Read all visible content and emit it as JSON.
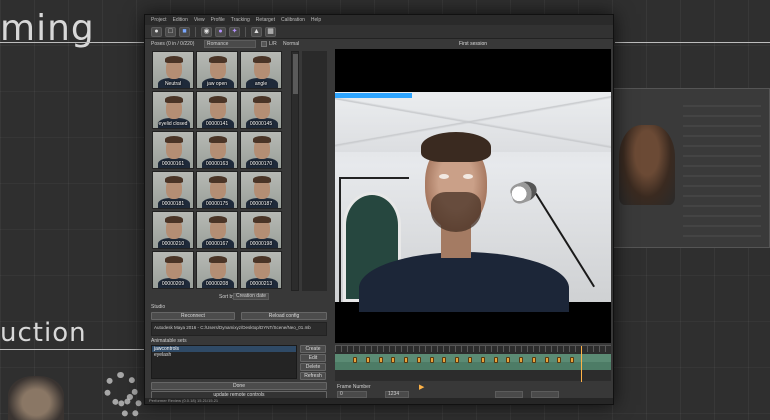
{
  "background": {
    "top_word": "ming",
    "bottom_word": "uction"
  },
  "app": {
    "menu": [
      "Project",
      "Edition",
      "View",
      "Profile",
      "Tracking",
      "Retarget",
      "Calibration",
      "Help"
    ],
    "toolbar_icons": [
      "profile-icon",
      "open-icon",
      "save-icon",
      "camera-icon",
      "record-icon",
      "pose-icon",
      "shape-icon",
      "window-icon"
    ],
    "left": {
      "header_title": "Poses (0 in / 0/220)",
      "view_select": "Romance",
      "lr_label": "L/R",
      "normal_label": "Normal",
      "thumbnails": [
        "Neutral",
        "jaw open",
        "angle",
        "eyelid closed",
        "00000141",
        "00000145",
        "00000161",
        "00000163",
        "00000170",
        "00000181",
        "00000175",
        "00000187",
        "00000210",
        "00000167",
        "00000198",
        "00000209",
        "00000208",
        "00000213"
      ],
      "sort_label": "Sort by",
      "sort_value": "Creation date",
      "studio_label": "Studio",
      "reconnect_button": "Reconnect",
      "config_button": "Reload config",
      "path_text": "Autodesk Maya 2016 - C:/Users/Dynamixyz/Desktop/DYNT/Scene/Neo_01.mb",
      "anim_label": "Animatable sets",
      "anim_items": [
        {
          "label": "jawcontrols",
          "selected": true
        },
        {
          "label": "eyelash",
          "selected": false
        }
      ],
      "side_buttons": [
        "Create",
        "Edit",
        "Delete",
        "Refresh"
      ],
      "bottom_button": "Done",
      "bottom_button2": "update remote controls"
    },
    "right": {
      "session_title": "First session",
      "progress": 0.28,
      "keyframe_count": 18,
      "frame_label": "Frame Number",
      "frame_value": "0",
      "end_value": "1234",
      "play_icon": "play-icon",
      "accent": "#2ea5ff",
      "keyframe_color": "#e8a33a"
    },
    "status": "Performer Review (0.0.18) 15.21/15.21"
  }
}
